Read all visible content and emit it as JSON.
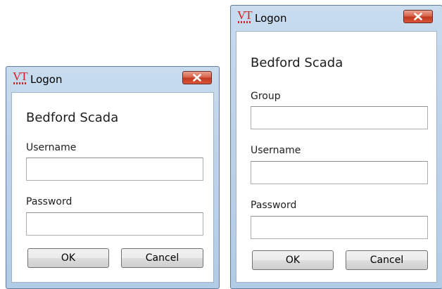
{
  "dialogs": [
    {
      "title": "Logon",
      "app_name": "Bedford Scada",
      "username_label": "Username",
      "username_value": "",
      "password_label": "Password",
      "password_value": "",
      "ok_label": "OK",
      "cancel_label": "Cancel"
    },
    {
      "title": "Logon",
      "app_name": "Bedford Scada",
      "group_label": "Group",
      "group_value": "",
      "username_label": "Username",
      "username_value": "",
      "password_label": "Password",
      "password_value": "",
      "ok_label": "OK",
      "cancel_label": "Cancel"
    }
  ],
  "logo": {
    "text": "VT",
    "icon": "vt-logo-icon",
    "color": "#d42020"
  },
  "icons": {
    "close": "close-icon"
  },
  "colors": {
    "close_button": "#c23a1f",
    "frame": "#b2cce6"
  }
}
